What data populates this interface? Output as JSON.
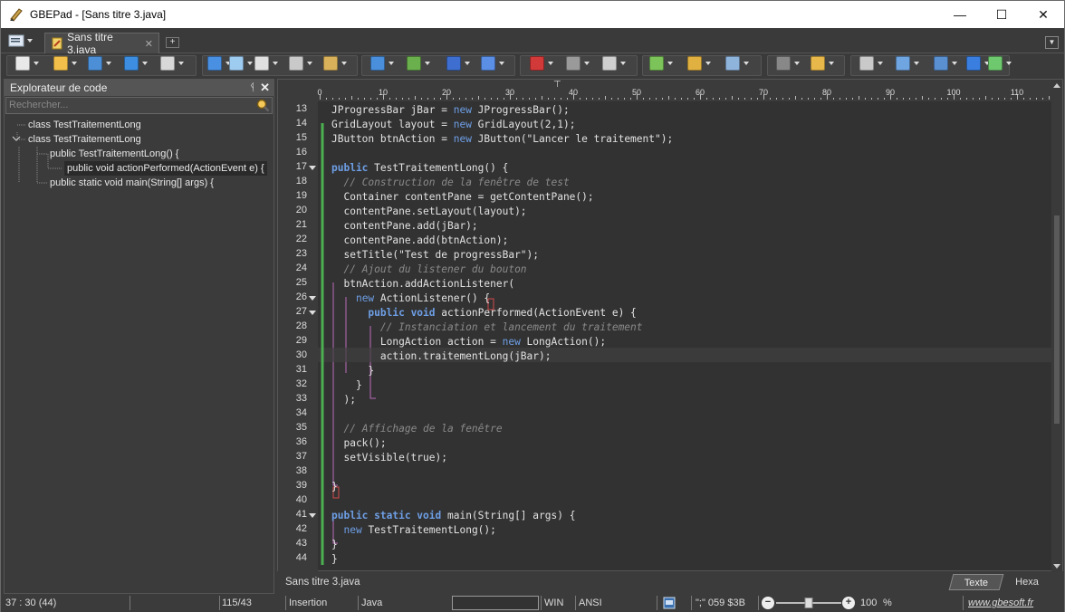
{
  "window": {
    "title": "GBEPad - [Sans titre 3.java]",
    "minimize_glyph": "—",
    "maximize_glyph": "☐",
    "close_glyph": "✕"
  },
  "tabs": {
    "active_tab_label": "Sans titre 3.java",
    "close_glyph": "✕",
    "new_tab_glyph": "+"
  },
  "toolbar": {
    "icons": [
      "new-file-icon",
      "open-folder-icon",
      "save-icon",
      "browse-icon",
      "print-icon",
      "undo-icon",
      "redo-icon",
      "copy-icon",
      "cut-icon",
      "paste-icon",
      "search-icon",
      "replace-icon",
      "goto-icon",
      "format-icon",
      "text-color-icon",
      "indent-icon",
      "run-icon",
      "plugin-icon",
      "user-icon",
      "tools-icon",
      "macro-icon",
      "edit-icon",
      "settings-icon",
      "display-icon",
      "web-icon",
      "help-icon",
      "money-icon"
    ]
  },
  "explorer": {
    "title": "Explorateur de code",
    "pin_glyph": "ᛩ",
    "close_glyph": "✕",
    "search_placeholder": "Rechercher...",
    "tree": [
      "class TestTraitementLong",
      "class TestTraitementLong",
      "public TestTraitementLong() {",
      "public void actionPerformed(ActionEvent e) {",
      "public static void main(String[] args) {"
    ]
  },
  "ruler": {
    "labels": [
      "0",
      "10",
      "20",
      "30",
      "40",
      "50",
      "60",
      "70",
      "80",
      "90",
      "100",
      "110"
    ]
  },
  "editor": {
    "lines": [
      {
        "n": "13",
        "fold": false,
        "html": "JProgressBar jBar = <span class=\"kn\">new</span> JProgressBar();"
      },
      {
        "n": "14",
        "fold": false,
        "html": "GridLayout layout = <span class=\"kn\">new</span> GridLayout(2,1);"
      },
      {
        "n": "15",
        "fold": false,
        "html": "JButton btnAction = <span class=\"kn\">new</span> JButton(\"Lancer le traitement\");"
      },
      {
        "n": "16",
        "fold": false,
        "html": ""
      },
      {
        "n": "17",
        "fold": true,
        "html": "<span class=\"kw\">public</span> TestTraitementLong() {"
      },
      {
        "n": "18",
        "fold": false,
        "html": "  <span class=\"cm\">// Construction de la fenêtre de test</span>"
      },
      {
        "n": "19",
        "fold": false,
        "html": "  Container contentPane = getContentPane();"
      },
      {
        "n": "20",
        "fold": false,
        "html": "  contentPane.setLayout(layout);"
      },
      {
        "n": "21",
        "fold": false,
        "html": "  contentPane.add(jBar);"
      },
      {
        "n": "22",
        "fold": false,
        "html": "  contentPane.add(btnAction);"
      },
      {
        "n": "23",
        "fold": false,
        "html": "  setTitle(\"Test de progressBar\");"
      },
      {
        "n": "24",
        "fold": false,
        "html": "  <span class=\"cm\">// Ajout du listener du bouton</span>"
      },
      {
        "n": "25",
        "fold": false,
        "html": "  btnAction.addActionListener("
      },
      {
        "n": "26",
        "fold": true,
        "html": "    <span class=\"kn\">new</span> ActionListener() {"
      },
      {
        "n": "27",
        "fold": true,
        "html": "      <span class=\"kw\">public void</span> actionPerformed(ActionEvent e) {"
      },
      {
        "n": "28",
        "fold": false,
        "html": "        <span class=\"cm\">// Instanciation et lancement du traitement</span>"
      },
      {
        "n": "29",
        "fold": false,
        "html": "        LongAction action = <span class=\"kn\">new</span> LongAction();"
      },
      {
        "n": "30",
        "fold": false,
        "html": "        action.traitementLong(jBar);"
      },
      {
        "n": "31",
        "fold": false,
        "html": "      }"
      },
      {
        "n": "32",
        "fold": false,
        "html": "    }"
      },
      {
        "n": "33",
        "fold": false,
        "html": "  );"
      },
      {
        "n": "34",
        "fold": false,
        "html": ""
      },
      {
        "n": "35",
        "fold": false,
        "html": "  <span class=\"cm\">// Affichage de la fenêtre</span>"
      },
      {
        "n": "36",
        "fold": false,
        "html": "  pack();"
      },
      {
        "n": "37",
        "fold": false,
        "html": "  setVisible(true);"
      },
      {
        "n": "38",
        "fold": false,
        "html": ""
      },
      {
        "n": "39",
        "fold": false,
        "html": "}"
      },
      {
        "n": "40",
        "fold": false,
        "html": ""
      },
      {
        "n": "41",
        "fold": true,
        "html": "<span class=\"kw\">public static void</span> main(String[] args) {"
      },
      {
        "n": "42",
        "fold": false,
        "html": "  <span class=\"kn\">new</span> TestTraitementLong();"
      },
      {
        "n": "43",
        "fold": false,
        "html": "}"
      },
      {
        "n": "44",
        "fold": false,
        "html": "}"
      }
    ]
  },
  "docbar": {
    "filename": "Sans titre 3.java",
    "view_text": "Texte",
    "view_hex": "Hexa"
  },
  "status": {
    "position": "37 : 30 (44)",
    "lines": "115/43",
    "mode": "Insertion",
    "language": "Java",
    "eol": "WIN",
    "encoding": "ANSI",
    "char_info": "\";\" 059 $3B",
    "zoom_minus": "−",
    "zoom_plus": "+",
    "zoom": "100",
    "zoom_unit": "%",
    "zoom_level": 0.5,
    "website": "www.gbesoft.fr"
  }
}
